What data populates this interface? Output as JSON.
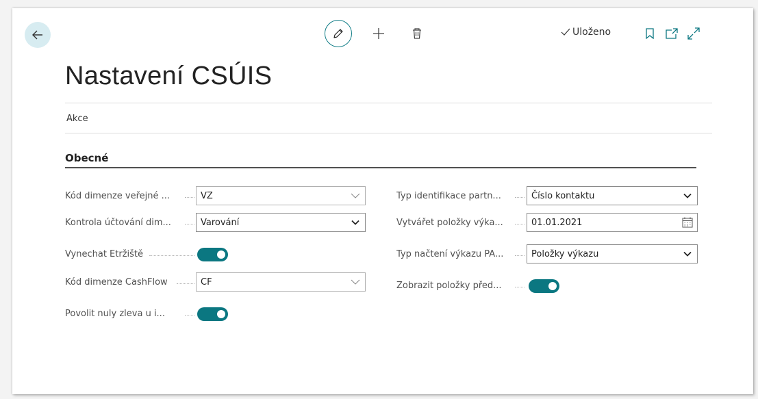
{
  "page": {
    "title": "Nastavení CSÚIS",
    "status": "Uloženo",
    "actions_label": "Akce"
  },
  "colors": {
    "accent": "#0b7781",
    "back_button_bg": "#d7ecf1"
  },
  "icons": {
    "back": "arrow-left-icon",
    "edit": "pencil-icon",
    "new": "plus-icon",
    "delete": "trash-icon",
    "saved": "checkmark-icon",
    "bookmark": "bookmark-icon",
    "open_new": "open-in-new-window-icon",
    "expand": "expand-icon"
  },
  "section": {
    "title": "Obecné"
  },
  "fields_left": [
    {
      "label": "Kód dimenze veřejné ...",
      "type": "select-light",
      "value": "VZ"
    },
    {
      "label": "Kontrola účtování dim...",
      "type": "select",
      "value": "Varování"
    },
    {
      "label": "Vynechat Etržiště",
      "type": "toggle",
      "on": true
    },
    {
      "label": "Kód dimenze CashFlow",
      "type": "select-light",
      "value": "CF"
    },
    {
      "label": "Povolit nuly zleva u i...",
      "type": "toggle",
      "on": true
    }
  ],
  "fields_right": [
    {
      "label": "Typ identifikace partn...",
      "type": "select",
      "value": "Číslo kontaktu"
    },
    {
      "label": "Vytvářet položky výka...",
      "type": "date",
      "value": "01.01.2021"
    },
    {
      "label": "Typ načtení výkazu PA...",
      "type": "select",
      "value": "Položky výkazu"
    },
    {
      "label": "Zobrazit položky před...",
      "type": "toggle",
      "on": true
    }
  ]
}
